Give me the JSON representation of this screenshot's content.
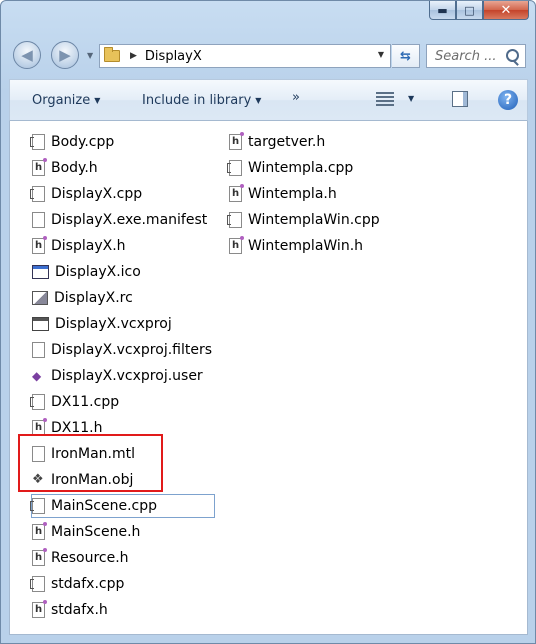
{
  "window": {
    "buttons": {
      "minimize": "▬",
      "maximize": "□",
      "close": "✕"
    }
  },
  "nav": {
    "back_glyph": "◀",
    "forward_glyph": "▶",
    "history_glyph": "▼"
  },
  "address": {
    "separator": "▶",
    "path": "DisplayX",
    "dropdown_glyph": "▼",
    "refresh_glyph": "⇆"
  },
  "search": {
    "placeholder": "Search ..."
  },
  "toolbar": {
    "organize": "Organize",
    "include_in_library": "Include in library",
    "more": "»",
    "dropdown_glyph": "▼",
    "help_glyph": "?"
  },
  "files": {
    "col1": [
      {
        "name": "Body.cpp",
        "icon": "cpp-file-icon"
      },
      {
        "name": "Body.h",
        "icon": "header-file-icon"
      },
      {
        "name": "DisplayX.cpp",
        "icon": "cpp-file-icon"
      },
      {
        "name": "DisplayX.exe.manifest",
        "icon": "blank-file-icon"
      },
      {
        "name": "DisplayX.h",
        "icon": "header-file-icon"
      },
      {
        "name": "DisplayX.ico",
        "icon": "ico-file-icon"
      },
      {
        "name": "DisplayX.rc",
        "icon": "rc-file-icon"
      },
      {
        "name": "DisplayX.vcxproj",
        "icon": "vcxproj-file-icon"
      },
      {
        "name": "DisplayX.vcxproj.filters",
        "icon": "blank-file-icon"
      },
      {
        "name": "DisplayX.vcxproj.user",
        "icon": "vs-user-file-icon"
      },
      {
        "name": "DX11.cpp",
        "icon": "cpp-file-icon"
      },
      {
        "name": "DX11.h",
        "icon": "header-file-icon"
      },
      {
        "name": "IronMan.mtl",
        "icon": "blank-file-icon"
      },
      {
        "name": "IronMan.obj",
        "icon": "obj-file-icon"
      },
      {
        "name": "MainScene.cpp",
        "icon": "cpp-file-icon"
      },
      {
        "name": "MainScene.h",
        "icon": "header-file-icon"
      },
      {
        "name": "Resource.h",
        "icon": "header-file-icon"
      },
      {
        "name": "stdafx.cpp",
        "icon": "cpp-file-icon"
      },
      {
        "name": "stdafx.h",
        "icon": "header-file-icon"
      }
    ],
    "col2": [
      {
        "name": "targetver.h",
        "icon": "header-file-icon"
      },
      {
        "name": "Wintempla.cpp",
        "icon": "cpp-file-icon"
      },
      {
        "name": "Wintempla.h",
        "icon": "header-file-icon"
      },
      {
        "name": "WintemplaWin.cpp",
        "icon": "cpp-file-icon"
      },
      {
        "name": "WintemplaWin.h",
        "icon": "header-file-icon"
      }
    ]
  }
}
